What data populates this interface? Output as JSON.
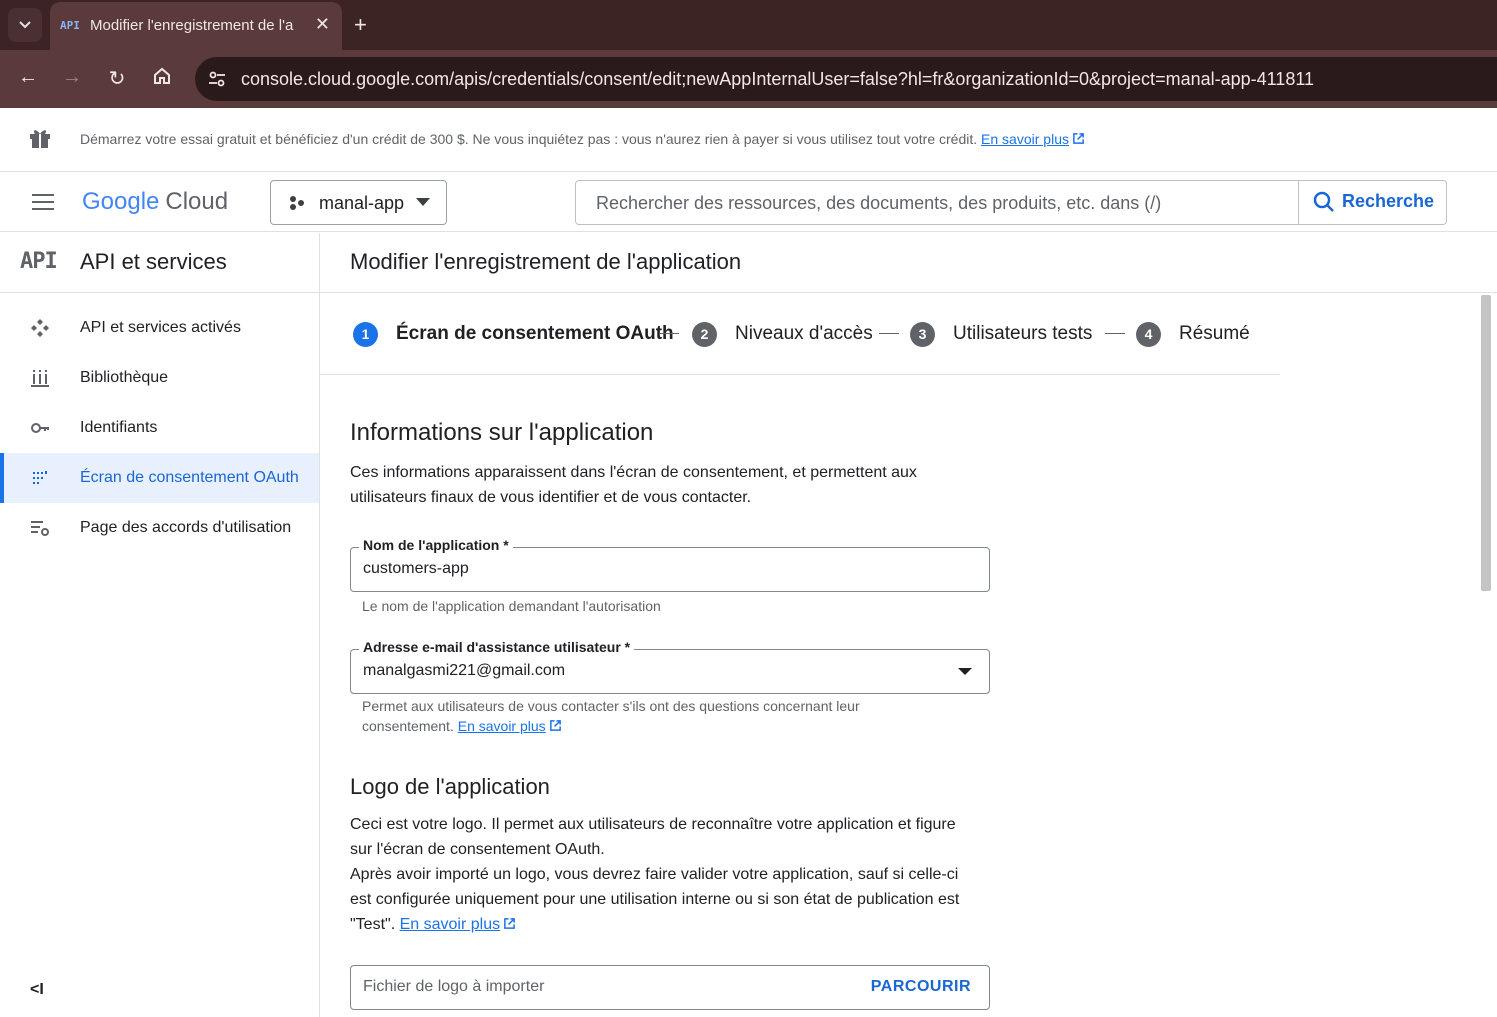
{
  "browser": {
    "tab_title": "Modifier l'enregistrement de l'a",
    "tab_favicon": "API",
    "url": "console.cloud.google.com/apis/credentials/consent/edit;newAppInternalUser=false?hl=fr&organizationId=0&project=manal-app-411811"
  },
  "promo": {
    "text": "Démarrez votre essai gratuit et bénéficiez d'un crédit de 300 $. Ne vous inquiétez pas : vous n'aurez rien à payer si vous utilisez tout votre crédit.",
    "link": "En savoir plus"
  },
  "header": {
    "logo_google": "Google",
    "logo_cloud": "Cloud",
    "project_name": "manal-app",
    "search_placeholder": "Rechercher des ressources, des documents, des produits, etc. dans (/)",
    "search_button": "Recherche"
  },
  "sidebar": {
    "icon_text": "API",
    "title": "API et services",
    "items": [
      {
        "label": "API et services activés",
        "icon": "hub-icon"
      },
      {
        "label": "Bibliothèque",
        "icon": "library-icon"
      },
      {
        "label": "Identifiants",
        "icon": "key-icon"
      },
      {
        "label": "Écran de consentement OAuth",
        "icon": "consent-icon",
        "active": true
      },
      {
        "label": "Page des accords d'utilisation",
        "icon": "settings-list-icon"
      }
    ]
  },
  "main": {
    "title": "Modifier l'enregistrement de l'application",
    "steps": [
      {
        "num": "1",
        "label": "Écran de consentement OAuth",
        "active": true
      },
      {
        "num": "2",
        "label": "Niveaux d'accès"
      },
      {
        "num": "3",
        "label": "Utilisateurs tests"
      },
      {
        "num": "4",
        "label": "Résumé"
      }
    ],
    "app_info": {
      "heading": "Informations sur l'application",
      "desc_line1": "Ces informations apparaissent dans l'écran de consentement, et permettent aux",
      "desc_line2": "utilisateurs finaux de vous identifier et de vous contacter.",
      "app_name_label": "Nom de l'application *",
      "app_name_value": "customers-app",
      "app_name_hint": "Le nom de l'application demandant l'autorisation",
      "email_label": "Adresse e-mail d'assistance utilisateur *",
      "email_value": "manalgasmi221@gmail.com",
      "email_hint_line1": "Permet aux utilisateurs de vous contacter s'ils ont des questions concernant leur",
      "email_hint_line2": "consentement.",
      "email_hint_link": "En savoir plus"
    },
    "logo": {
      "heading": "Logo de l'application",
      "line1": "Ceci est votre logo. Il permet aux utilisateurs de reconnaître votre application et figure",
      "line2": "sur l'écran de consentement OAuth.",
      "line3": "Après avoir importé un logo, vous devrez faire valider votre application, sauf si celle-ci",
      "line4": "est configurée uniquement pour une utilisation interne ou si son état de publication est",
      "line5": "\"Test\".",
      "link": "En savoir plus",
      "upload_placeholder": "Fichier de logo à importer",
      "upload_button": "PARCOURIR"
    }
  },
  "colors": {
    "accent": "#1a73e8",
    "chrome_bg": "#3c2324",
    "active_bg": "#e8f0fe"
  }
}
